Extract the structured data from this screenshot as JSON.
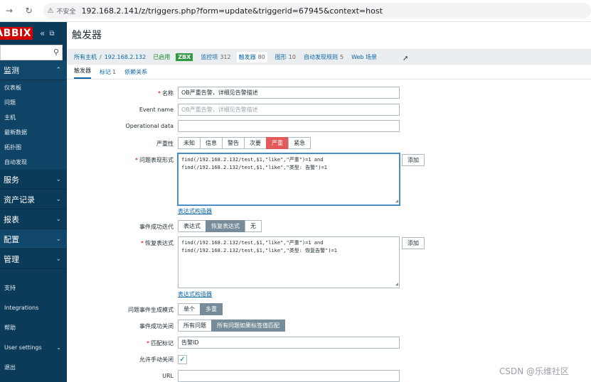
{
  "browser": {
    "security_label": "不安全",
    "url": "192.168.2.141/z/triggers.php?form=update&triggerid=67945&context=host"
  },
  "sidebar": {
    "logo": "ABBIX",
    "sections": [
      {
        "label": "监测",
        "items": [
          "仪表板",
          "问题",
          "主机",
          "最新数据",
          "拓扑图",
          "自动发现"
        ]
      },
      {
        "label": "服务"
      },
      {
        "label": "资产记录"
      },
      {
        "label": "报表"
      },
      {
        "label": "配置"
      },
      {
        "label": "管理"
      }
    ],
    "bottom": [
      "支持",
      "Integrations",
      "帮助",
      "User settings",
      "退出"
    ]
  },
  "page": {
    "title": "触发器",
    "breadcrumb": {
      "all_hosts": "所有主机",
      "host": "192.168.2.132",
      "status": "已启用",
      "zbx": "ZBX",
      "items": [
        {
          "label": "监控项",
          "count": "312"
        },
        {
          "label": "触发器",
          "count": "80"
        },
        {
          "label": "图形",
          "count": "10"
        },
        {
          "label": "自动发现规则",
          "count": "5"
        },
        {
          "label": "Web 场景",
          "count": ""
        }
      ]
    },
    "tabs": [
      {
        "label": "触发器",
        "count": ""
      },
      {
        "label": "标记",
        "count": "1"
      },
      {
        "label": "依赖关系",
        "count": ""
      }
    ]
  },
  "form": {
    "name_label": "名称",
    "name_value": "OB严重告警，详细见告警描述",
    "event_name_label": "Event name",
    "event_name_placeholder": "OB严重告警，详细见告警描述",
    "operational_label": "Operational data",
    "operational_value": "",
    "severity_label": "严重性",
    "severities": [
      "未知",
      "信息",
      "警告",
      "次要",
      "严重",
      "紧急"
    ],
    "severity_selected": "严重",
    "problem_expr_label": "问题表现形式",
    "problem_expr": "find(/192.168.2.132/test,$1,\"like\",\"严重\")=1 and\nfind(/192.168.2.132/test,$1,\"like\",\"类型: 告警\")=1",
    "add_label": "添加",
    "expr_builder_label": "表达式构造器",
    "ok_event_label": "事件成功迭代",
    "ok_event_options": [
      "表达式",
      "恢复表达式",
      "无"
    ],
    "ok_event_selected": "恢复表达式",
    "recovery_expr_label": "恢复表达式",
    "recovery_expr": "find(/192.168.2.132/test,$1,\"like\",\"严重\")=1 and\nfind(/192.168.2.132/test,$1,\"like\",\"类型: 恢复告警\")=1",
    "gen_mode_label": "问题事件生成模式",
    "gen_mode_options": [
      "单个",
      "多重"
    ],
    "gen_mode_selected": "多重",
    "ok_close_label": "事件成功关闭",
    "ok_close_options": [
      "所有问题",
      "所有问题如果标签值匹配"
    ],
    "ok_close_selected": "所有问题如果标签值匹配",
    "match_tag_label": "匹配标记",
    "match_tag_value": "告警ID",
    "manual_close_label": "允许手动关闭",
    "manual_close_checked": true,
    "url_label": "URL",
    "url_value": ""
  },
  "watermark": "CSDN @乐维社区"
}
